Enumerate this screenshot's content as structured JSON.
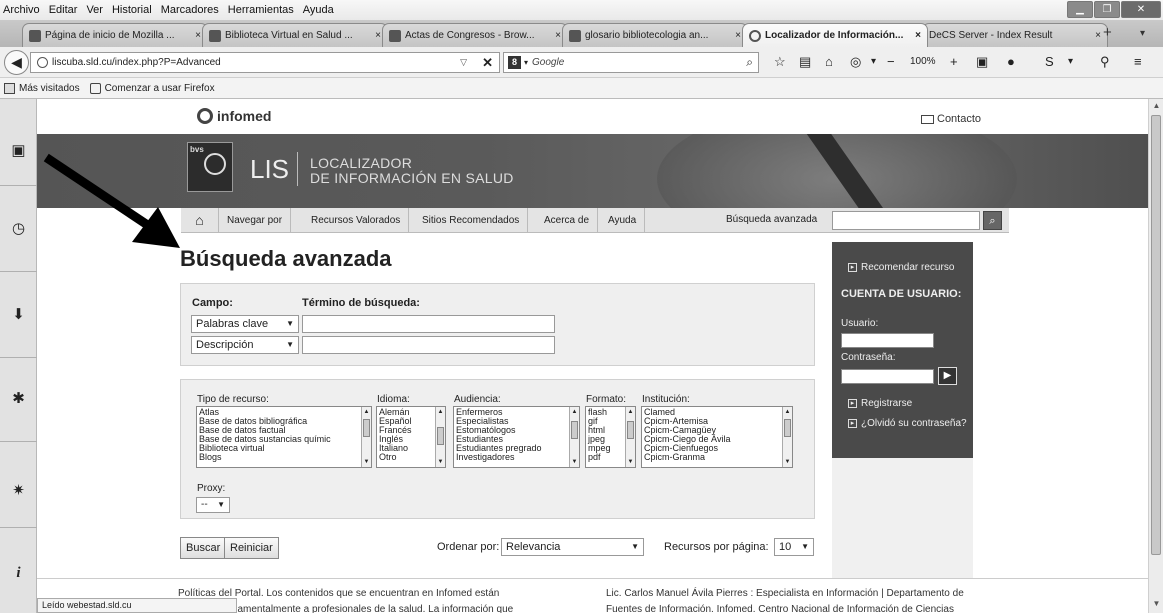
{
  "menubar": {
    "items": [
      "Archivo",
      "Editar",
      "Ver",
      "Historial",
      "Marcadores",
      "Herramientas",
      "Ayuda"
    ]
  },
  "tabs": [
    {
      "title": "Página de inicio de Mozilla ..."
    },
    {
      "title": "Biblioteca Virtual en Salud ..."
    },
    {
      "title": "Actas de Congresos - Brow..."
    },
    {
      "title": "glosario bibliotecologia an..."
    },
    {
      "title": "Localizador de Información..."
    },
    {
      "title": "DeCS Server - Index Result"
    }
  ],
  "tab_new_label": "+",
  "navbar": {
    "url": "liscuba.sld.cu/index.php?P=Advanced",
    "search_engine_badge": "8",
    "search_placeholder": "Google",
    "zoom": "100%"
  },
  "bookmarks": {
    "items": [
      "Más visitados",
      "Comenzar a usar Firefox"
    ]
  },
  "page": {
    "infomed_label": "infomed",
    "contact_label": "Contacto",
    "bvs_label": "bvs",
    "lis_label": "LIS",
    "localizador_line1": "LOCALIZADOR",
    "localizador_line2": "DE INFORMACIÓN EN SALUD",
    "nav": [
      "Navegar por",
      "Recursos Valorados",
      "Sitios Recomendados",
      "Acerca de",
      "Ayuda"
    ],
    "nav_search_label": "Búsqueda avanzada",
    "title": "Búsqueda avanzada",
    "campo_label": "Campo:",
    "termino_label": "Término de búsqueda:",
    "field1_value": "Palabras clave",
    "field2_value": "Descripción",
    "tipo_label": "Tipo de recurso:",
    "tipo_options": [
      "Atlas",
      "Base de datos bibliográfica",
      "Base de datos factual",
      "Base de datos sustancias químic",
      "Biblioteca virtual",
      "Blogs"
    ],
    "idioma_label": "Idioma:",
    "idioma_options": [
      "Alemán",
      "Español",
      "Francés",
      "Inglés",
      "Italiano",
      "Otro"
    ],
    "audiencia_label": "Audiencia:",
    "audiencia_options": [
      "Enfermeros",
      "Especialistas",
      "Estomatólogos",
      "Estudiantes",
      "Estudiantes pregrado",
      "Investigadores"
    ],
    "formato_label": "Formato:",
    "formato_options": [
      "flash",
      "gif",
      "html",
      "jpeg",
      "mpeg",
      "pdf"
    ],
    "institucion_label": "Institución:",
    "institucion_options": [
      "Clamed",
      "Cpicm-Artemisa",
      "Cpicm-Camagüey",
      "Cpicm-Ciego de Ávila",
      "Cpicm-Cienfuegos",
      "Cpicm-Granma"
    ],
    "proxy_label": "Proxy:",
    "proxy_value": "--",
    "buscar_label": "Buscar",
    "reiniciar_label": "Reiniciar",
    "ordenar_label": "Ordenar por:",
    "ordenar_value": "Relevancia",
    "recursos_label": "Recursos por página:",
    "recursos_value": "10",
    "side_recomendar": "Recomendar recurso",
    "side_cuenta": "CUENTA DE USUARIO:",
    "side_usuario": "Usuario:",
    "side_contrasena": "Contraseña:",
    "side_registrarse": "Registrarse",
    "side_olvido": "¿Olvidó su contraseña?",
    "footer_left_1": "Políticas del Portal. Los contenidos que se encuentran en Infomed están",
    "footer_left_2": "dirigidos fundamentalmente a profesionales de la salud. La información que",
    "footer_right_1": "Lic. Carlos Manuel Ávila Pierres : Especialista en Información | Departamento de",
    "footer_right_2": "Fuentes de Información. Infomed. Centro Nacional de Información de Ciencias"
  },
  "status_text": "Leído webestad.sld.cu"
}
